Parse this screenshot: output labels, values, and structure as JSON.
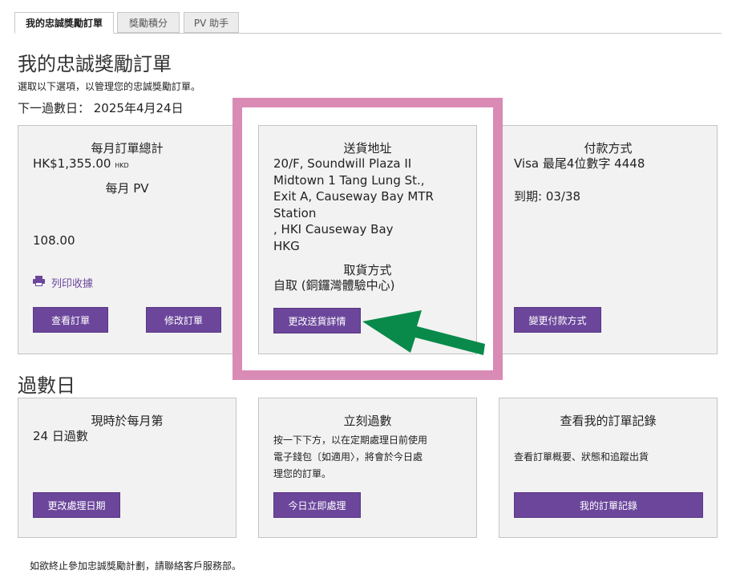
{
  "tabs": [
    {
      "label": "我的忠誠獎勵訂單",
      "active": true
    },
    {
      "label": "獎勵積分",
      "active": false
    },
    {
      "label": "PV 助手",
      "active": false
    }
  ],
  "page": {
    "title": "我的忠誠獎勵訂單",
    "subtitle": "選取以下選項，以管理您的忠誠獎勵訂單。",
    "next_date": "下一過數日： 2025年4月24日"
  },
  "order_total_card": {
    "title": "每月訂單總計",
    "amount": "HK$1,355.00",
    "currency": "HKD",
    "pv_label": "每月 PV",
    "pv_value": "108.00",
    "print_label": "列印收據",
    "view_button": "查看訂單",
    "edit_button": "修改訂單"
  },
  "shipping_card": {
    "title": "送貨地址",
    "address_lines": [
      "20/F, Soundwill Plaza II",
      "Midtown 1 Tang Lung St.,",
      "Exit A, Causeway Bay MTR",
      "Station",
      ", HKI Causeway Bay",
      "HKG"
    ],
    "pickup_title": "取貨方式",
    "pickup_value": "自取 (銅鑼灣體驗中心)",
    "change_button": "更改送貨詳情"
  },
  "payment_card": {
    "title": "付款方式",
    "card_text": "Visa 最尾4位數字 4448",
    "expiry": "到期: 03/38",
    "change_button": "變更付款方式"
  },
  "section2_title": "過數日",
  "process_date_card": {
    "title": "現時於每月第",
    "value": "24 日過數",
    "button": "更改處理日期"
  },
  "process_now_card": {
    "title": "立刻過數",
    "desc_lines": [
      "按一下下方，以在定期處理日前使用",
      "電子錢包〔如適用〉，將會於今日處",
      "理您的訂單。"
    ],
    "button": "今日立即處理"
  },
  "history_card": {
    "title": "查看我的訂單記錄",
    "desc": "查看訂單概要、狀態和追蹤出貨",
    "button": "我的訂單記錄"
  },
  "footer": "如欲終止參加忠誠獎勵計劃，請聯絡客戶服務部。",
  "colors": {
    "button": "#6b469b",
    "highlight_border": "#d98bb5",
    "arrow": "#0a8a4a",
    "card_bg": "#f2f2f2"
  },
  "icons": [
    "printer-icon",
    "arrow-pointer-icon"
  ]
}
